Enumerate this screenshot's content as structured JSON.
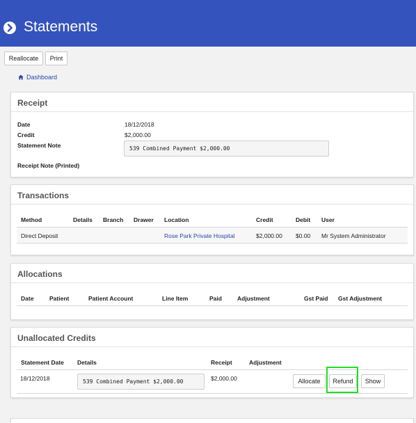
{
  "header": {
    "title": "Statements",
    "top_fragments": [
      "",
      "",
      ""
    ]
  },
  "toolbar": {
    "reallocate_label": "Reallocate",
    "print_label": "Print"
  },
  "breadcrumb": {
    "dashboard_label": "Dashboard"
  },
  "receipt": {
    "title": "Receipt",
    "date_label": "Date",
    "date_value": "18/12/2018",
    "credit_label": "Credit",
    "credit_value": "$2,000.00",
    "statement_note_label": "Statement Note",
    "statement_note_value": "539 Combined Payment $2,000.00",
    "receipt_note_label": "Receipt Note (Printed)"
  },
  "transactions": {
    "title": "Transactions",
    "columns": [
      "Method",
      "Details",
      "Branch",
      "Drawer",
      "Location",
      "Credit",
      "Debit",
      "User"
    ],
    "rows": [
      [
        "Direct Deposit",
        "",
        "",
        "",
        "Rose Park Private Hospital",
        "$2,000.00",
        "$0.00",
        "Mr System Administrator"
      ]
    ]
  },
  "allocations": {
    "title": "Allocations",
    "columns": [
      "Date",
      "Patient",
      "Patient Account",
      "Line Item",
      "Paid",
      "Adjustment",
      "Gst Paid",
      "Gst Adjustment"
    ]
  },
  "unallocated": {
    "title": "Unallocated Credits",
    "columns": [
      "Statement Date",
      "Details",
      "Receipt",
      "Adjustment"
    ],
    "rows": [
      {
        "statement_date": "18/12/2018",
        "details": "539 Combined Payment $2,000.00",
        "receipt": "$2,000.00",
        "adjustment": "",
        "allocate_label": "Allocate",
        "refund_label": "Refund",
        "show_label": "Show"
      }
    ]
  },
  "colors": {
    "header_bg": "#3553bd",
    "link": "#2a47a8",
    "highlight": "#22dd22"
  }
}
